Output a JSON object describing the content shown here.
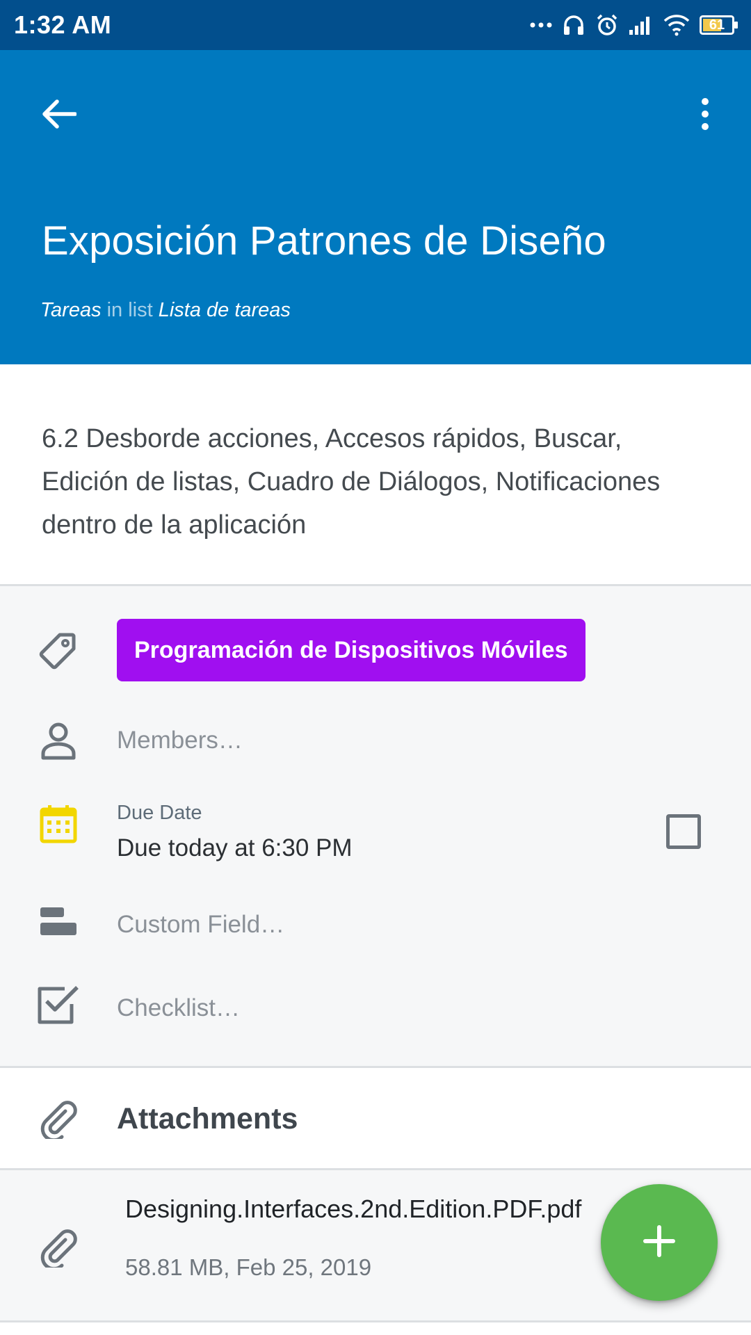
{
  "status_bar": {
    "time": "1:32 AM",
    "battery_level": "61",
    "icons": [
      "more-dots-icon",
      "headset-icon",
      "alarm-icon",
      "signal-icon",
      "wifi-icon",
      "battery-icon"
    ]
  },
  "header": {
    "back_icon": "back-arrow-icon",
    "overflow_icon": "overflow-menu-icon",
    "title": "Exposición Patrones de Diseño",
    "board": "Tareas",
    "separator": "in list",
    "list": "Lista de tareas"
  },
  "description": "6.2 Desborde acciones, Accesos rápidos, Buscar, Edición de listas, Cuadro de Diálogos, Notificaciones dentro de la aplicación",
  "details": {
    "label": {
      "icon": "tag-icon",
      "text": "Programación de Dispositivos Móviles",
      "color": "#a00ff0"
    },
    "members": {
      "icon": "person-icon",
      "placeholder": "Members…"
    },
    "due_date": {
      "icon": "calendar-icon",
      "icon_color": "#f2d600",
      "caption": "Due Date",
      "value": "Due today at 6:30 PM",
      "completed": false
    },
    "custom_field": {
      "icon": "custom-field-icon",
      "placeholder": "Custom Field…"
    },
    "checklist": {
      "icon": "checklist-icon",
      "placeholder": "Checklist…"
    }
  },
  "attachments": {
    "icon": "paperclip-icon",
    "title": "Attachments",
    "items": [
      {
        "icon": "paperclip-icon",
        "name": "Designing.Interfaces.2nd.Edition.PDF.pdf",
        "meta": "58.81 MB, Feb 25, 2019"
      }
    ]
  },
  "fab": {
    "icon": "plus-icon",
    "color": "#5ab950"
  },
  "colors": {
    "status_bar": "#024f8d",
    "header": "#0079bf",
    "details_background": "#f6f7f8"
  }
}
